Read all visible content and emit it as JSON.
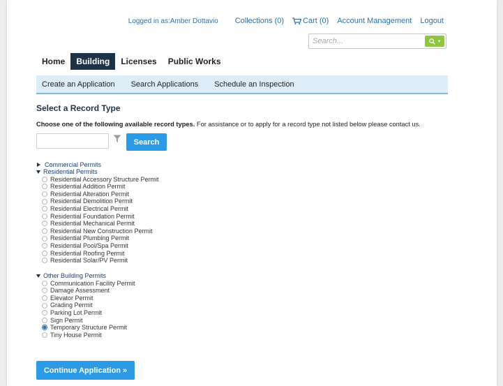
{
  "header": {
    "logged_in": "Logged in as:Amber Dottavio",
    "collections": "Collections (0)",
    "cart": "Cart (0)",
    "account": "Account Management",
    "logout": "Logout",
    "search_placeholder": "Search..."
  },
  "nav": {
    "tabs": [
      {
        "label": "Home"
      },
      {
        "label": "Building"
      },
      {
        "label": "Licenses"
      },
      {
        "label": "Public Works"
      }
    ],
    "active": "Building",
    "subtabs": [
      {
        "label": "Create an Application"
      },
      {
        "label": "Search Applications"
      },
      {
        "label": "Schedule an Inspection"
      }
    ]
  },
  "content": {
    "title": "Select a Record Type",
    "instruction_bold": "Choose one of the following available record types.",
    "instruction_rest": " For assistance or to apply for a record type not listed below please contact us.",
    "search_button": "Search",
    "groups": [
      {
        "label": "Commercial Permits",
        "expanded": false,
        "items": []
      },
      {
        "label": "Residential Permits",
        "expanded": true,
        "items": [
          "Residential Accessory Structure Permit",
          "Residential Addition Permit",
          "Residential Alteration Permit",
          "Residential Demolition Permit",
          "Residential Electrical Permit",
          "Residential Foundation Permit",
          "Residential Mechanical Permit",
          "Residential New Construction Permit",
          "Residential Plumbing Permit",
          "Residential Pool/Spa Permit",
          "Residential Roofing Permit",
          "Residential Solar/PV Permit"
        ]
      },
      {
        "label": "Other Building Permits",
        "expanded": true,
        "items": [
          "Communication Facility Permit",
          "Damage Assessment",
          "Elevator Permit",
          "Grading Permit",
          "Parking Lot Permit",
          "Sign Permit",
          "Temporary Structure Permit",
          "Tiny House Permit"
        ]
      }
    ],
    "selected": "Temporary Structure Permit",
    "continue_button": "Continue Application »"
  },
  "colors": {
    "link": "#2b6fb3",
    "primary_button": "#2b9be7",
    "nav_active": "#1d3348",
    "subnav_bg": "#dcedf8",
    "search_green": "#8dc63f"
  },
  "icons": {
    "cart": "cart-icon",
    "search": "search-icon",
    "filter": "funnel-icon"
  }
}
